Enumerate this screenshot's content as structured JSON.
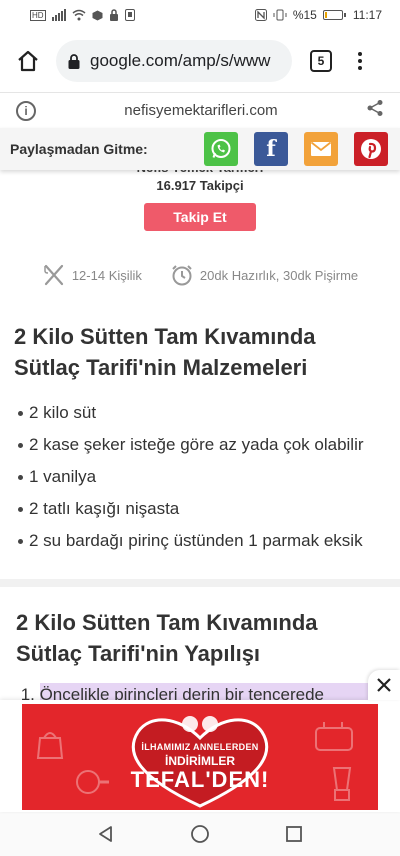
{
  "status_bar": {
    "battery": "%15",
    "time": "11:17",
    "battery_level": 0.15,
    "battery_color": "#e8a200"
  },
  "browser": {
    "url": "google.com/amp/s/www",
    "tab_count": "5"
  },
  "amp_header": {
    "domain": "nefisyemektarifleri.com"
  },
  "share": {
    "label": "Paylaşmadan Gitme:",
    "buttons": [
      {
        "icon": "whatsapp-icon",
        "color": "#4dc247"
      },
      {
        "icon": "facebook-icon",
        "color": "#3b5998"
      },
      {
        "icon": "email-icon",
        "color": "#f2a23a"
      },
      {
        "icon": "pinterest-icon",
        "color": "#cb2027"
      }
    ]
  },
  "author": {
    "name": "Nefis Yemek Tarifleri",
    "followers": "16.917 Takipçi",
    "follow_label": "Takip Et",
    "follow_color": "#ef5a6a"
  },
  "meta": {
    "servings": "12-14 Kişilik",
    "time": "20dk Hazırlık, 30dk Pişirme"
  },
  "ingredients": {
    "title": "2 Kilo Sütten Tam Kıvamında Sütlaç Tarifi'nin Malzemeleri",
    "items": [
      "2 kilo süt",
      "2 kase şeker isteğe göre az yada çok olabilir",
      "1 vanilya",
      "2 tatlı kaşığı nişasta",
      "2 su bardağı pirinç üstünden 1 parmak eksik"
    ]
  },
  "steps": {
    "title": "2 Kilo Sütten Tam Kıvamında Sütlaç Tarifi'nin Yapılışı",
    "items": [
      {
        "num": "1.",
        "text": "Öncelikle pirinçleri derin bir tencerede yumuşayıncaya kadar pişirelim."
      }
    ]
  },
  "ad": {
    "line1": "İLHAMIMIZ ANNELERDEN",
    "line2": "İNDİRİMLER",
    "line3": "TEFAL'DEN!",
    "bg_color": "#e3262b"
  }
}
